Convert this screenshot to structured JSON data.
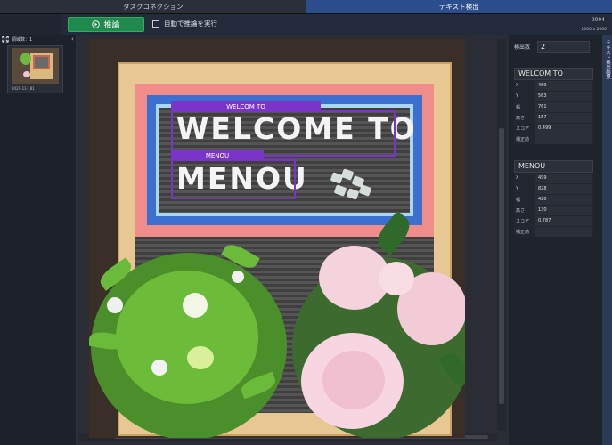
{
  "tabs": [
    {
      "label": "タスクコネクション",
      "active": false
    },
    {
      "label": "テキスト検出",
      "active": true
    }
  ],
  "toolbar": {
    "infer_label": "推論",
    "auto_label": "自動で推論を実行",
    "auto_checked": false,
    "counter": "0004",
    "resolution": "2000 x 2000"
  },
  "left_panel": {
    "region_count_label": "領域数：1",
    "thumbnail_caption": "2021-11-181"
  },
  "detections": [
    {
      "label": "WELCOM TO",
      "text": "WELCOME TO"
    },
    {
      "label": "MENOU",
      "text": "MENOU"
    }
  ],
  "right_panel": {
    "side_tab_label": "テキスト検出結果",
    "count_label": "検出数",
    "count_value": "2",
    "cards": [
      {
        "title": "WELCOM TO",
        "fields": [
          {
            "name": "X",
            "value": "489"
          },
          {
            "name": "Y",
            "value": "563"
          },
          {
            "name": "幅",
            "value": "761"
          },
          {
            "name": "高さ",
            "value": "157"
          },
          {
            "name": "スコア",
            "value": "0.499"
          },
          {
            "name": "補正前",
            "value": ""
          }
        ]
      },
      {
        "title": "MENOU",
        "fields": [
          {
            "name": "X",
            "value": "499"
          },
          {
            "name": "Y",
            "value": "828"
          },
          {
            "name": "幅",
            "value": "420"
          },
          {
            "name": "高さ",
            "value": "130"
          },
          {
            "name": "スコア",
            "value": "0.787"
          },
          {
            "name": "補正前",
            "value": ""
          }
        ]
      }
    ]
  },
  "colors": {
    "active_tab": "#2d4e8c",
    "infer_button": "#1f8a4c",
    "bbox": "#7b34c9"
  },
  "icons": {
    "infer": "play-icon",
    "expand": "expand-arrows-icon",
    "collapse": "chevron-left-icon"
  }
}
